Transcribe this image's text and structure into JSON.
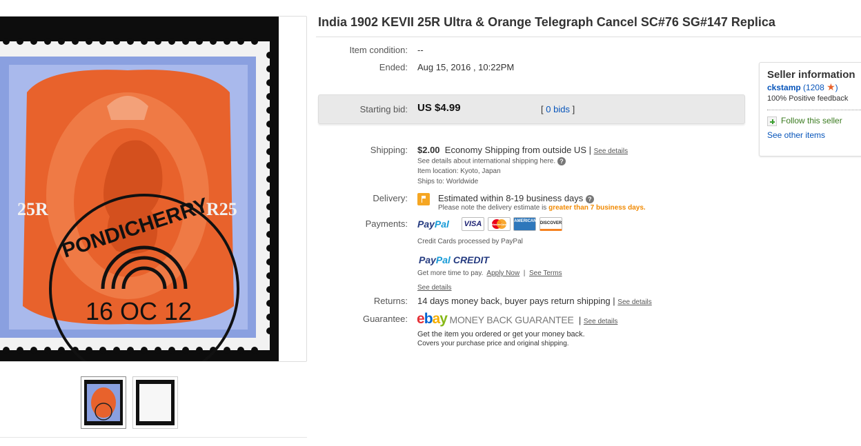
{
  "title": "India 1902 KEVII 25R Ultra & Orange Telegraph Cancel SC#76 SG#147 Replica",
  "item_condition": {
    "label": "Item condition:",
    "value": "--"
  },
  "ended": {
    "label": "Ended:",
    "value": "Aug 15, 2016 , 10:22PM"
  },
  "bid": {
    "label": "Starting bid:",
    "value": "US $4.99",
    "bids_open": "[",
    "bids_link": "0 bids",
    "bids_close": "]"
  },
  "shipping": {
    "label": "Shipping:",
    "cost": "$2.00",
    "method": "Economy Shipping from outside US |",
    "see_details": "See details",
    "intl_note": "See details about international shipping here.",
    "location": "Item location:  Kyoto, Japan",
    "ships_to": "Ships to:  Worldwide"
  },
  "delivery": {
    "label": "Delivery:",
    "estimate": "Estimated within 8-19 business days",
    "note_prefix": "Please note the delivery estimate is ",
    "note_highlight": "greater than 7 business days."
  },
  "payments": {
    "label": "Payments:",
    "paypal_a": "Pay",
    "paypal_b": "Pal",
    "cards": [
      "VISA",
      "MasterCard",
      "AMERICAN EXPRESS",
      "DISCOVER"
    ],
    "cc_note": "Credit Cards processed by PayPal",
    "credit_a": "Pay",
    "credit_b": "Pal",
    "credit_c": " CREDIT",
    "more_time": "Get more time to pay.",
    "apply_now": "Apply Now",
    "sep": "|",
    "see_terms": "See Terms",
    "see_details": "See details"
  },
  "returns": {
    "label": "Returns:",
    "text": "14 days money back, buyer pays return shipping |",
    "see_details": "See details"
  },
  "guarantee": {
    "label": "Guarantee:",
    "ebay": [
      "e",
      "b",
      "a",
      "y"
    ],
    "mbg": "MONEY BACK GUARANTEE",
    "sep": "|",
    "see_details": "See details",
    "line1": "Get the item you ordered or get your money back.",
    "line2": "Covers your purchase price and original shipping."
  },
  "seller": {
    "title": "Seller information",
    "name": "ckstamp",
    "score_open": "(",
    "score": "1208",
    "score_close": ")",
    "feedback": "100% Positive feedback",
    "follow": "Follow this seller",
    "other_items": "See other items"
  },
  "stamp": {
    "value_left": "25R",
    "value_right": "R25",
    "cancel": "PONDICHERRY",
    "date": "16 OC 12"
  },
  "colors": {
    "stamp_blue": "#8aa0e0",
    "stamp_orange": "#e8622c",
    "link_blue": "#0654ba",
    "accent_orange": "#f18900"
  }
}
